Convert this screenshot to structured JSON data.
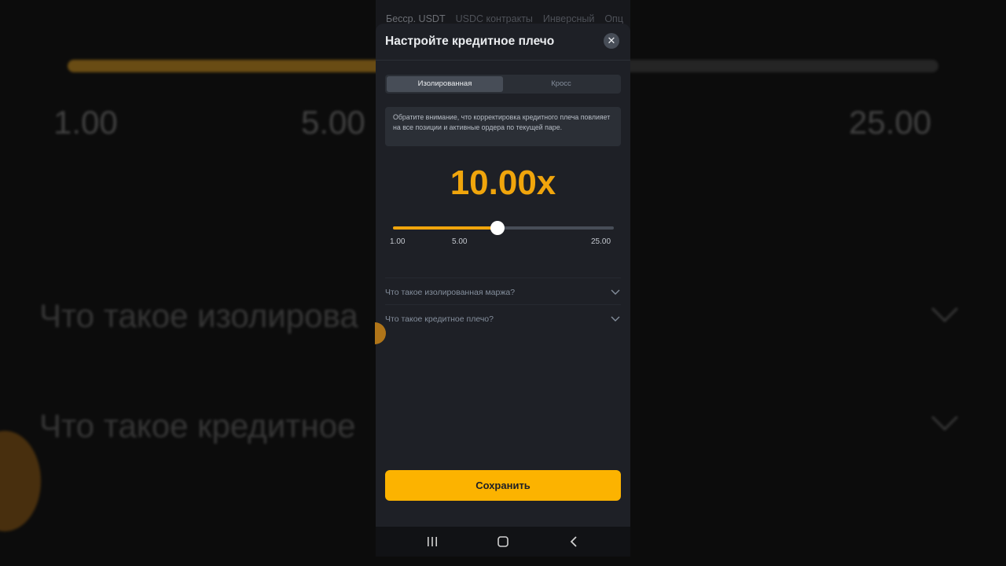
{
  "background": {
    "ticks": [
      "1.00",
      "5.00",
      "25.00"
    ],
    "questions": [
      "Что такое изолирова",
      "Что такое кредитное"
    ]
  },
  "top_tabs": [
    "Бесср. USDT",
    "USDC контракты",
    "Инверсный",
    "Опц"
  ],
  "sheet": {
    "title": "Настройте кредитное плечо",
    "close_icon": "close-icon",
    "mode_tabs": [
      {
        "label": "Изолированная",
        "active": true
      },
      {
        "label": "Кросс",
        "active": false
      }
    ],
    "notice": "Обратите внимание, что корректировка кредитного плеча повлияет на все позиции и активные ордера по текущей паре.",
    "leverage_display": "10.00x",
    "slider": {
      "min": 1,
      "max": 25,
      "value": 10,
      "value_fraction": 0.475,
      "ticks": [
        "1.00",
        "5.00",
        "25.00"
      ]
    },
    "faq": [
      {
        "question": "Что такое изолированная маржа?"
      },
      {
        "question": "Что такое кредитное плечо?"
      }
    ],
    "save_label": "Сохранить"
  },
  "colors": {
    "accent": "#f0a50c",
    "button": "#fcb300",
    "sheet_bg": "#1e2026"
  },
  "navbar": {
    "icons": [
      "recent-apps-icon",
      "home-icon",
      "back-icon"
    ]
  }
}
